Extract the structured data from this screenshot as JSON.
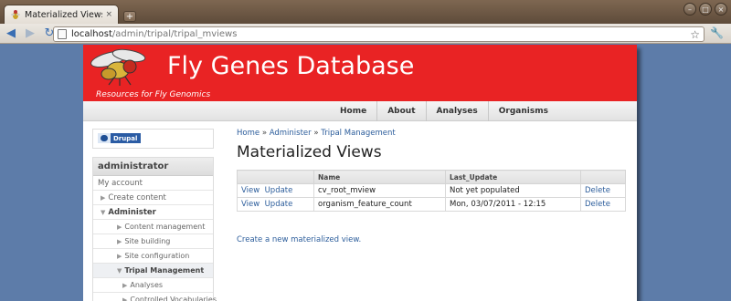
{
  "browser": {
    "tab_title": "Materialized Views | Fl...",
    "tab_close": "×",
    "new_tab": "+",
    "url_host": "localhost",
    "url_path": "/admin/tripal/tripal_mviews"
  },
  "site": {
    "name": "Fly Genes Database",
    "slogan": "Resources for Fly Genomics",
    "header_color": "#e92324",
    "primary_links": [
      "Home",
      "About",
      "Analyses",
      "Organisms"
    ]
  },
  "sidebar": {
    "drupal_badge": "Drupal",
    "user_block_title": "administrator",
    "menu": [
      {
        "label": "My account",
        "level": 0,
        "arrow": ""
      },
      {
        "label": "Create content",
        "level": 1,
        "arrow": "▶"
      },
      {
        "label": "Administer",
        "level": 1,
        "arrow": "▼",
        "bold": true
      },
      {
        "label": "Content management",
        "level": 2,
        "arrow": "▶"
      },
      {
        "label": "Site building",
        "level": 2,
        "arrow": "▶"
      },
      {
        "label": "Site configuration",
        "level": 2,
        "arrow": "▶"
      },
      {
        "label": "Tripal Management",
        "level": 2,
        "arrow": "▼",
        "bold": true
      },
      {
        "label": "Analyses",
        "level": 3,
        "arrow": "▶"
      },
      {
        "label": "Controlled Vocabularies",
        "level": 3,
        "arrow": "▶"
      }
    ]
  },
  "content": {
    "breadcrumb": [
      "Home",
      "Administer",
      "Tripal Management"
    ],
    "breadcrumb_sep": "»",
    "title": "Materialized Views",
    "table": {
      "headers": [
        "",
        "Name",
        "Last_Update",
        ""
      ],
      "rows": [
        {
          "view": "View",
          "update": "Update",
          "name": "cv_root_mview",
          "last_update": "Not yet populated",
          "delete": "Delete"
        },
        {
          "view": "View",
          "update": "Update",
          "name": "organism_feature_count",
          "last_update": "Mon, 03/07/2011 - 12:15",
          "delete": "Delete"
        }
      ]
    },
    "create_link": "Create a new materialized view."
  }
}
